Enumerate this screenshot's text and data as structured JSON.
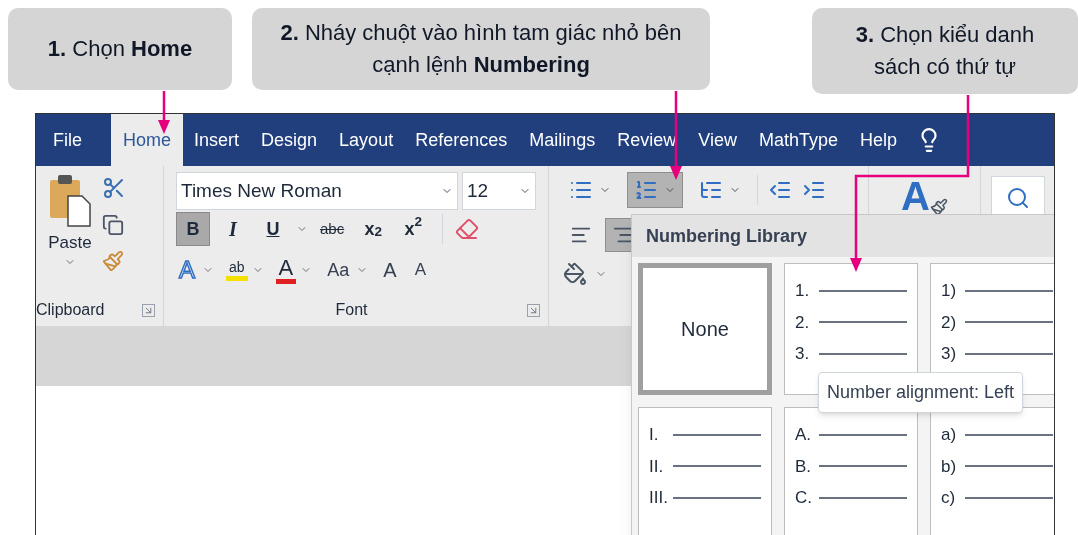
{
  "callouts": [
    {
      "text": "**1.** Chọn **Home**"
    },
    {
      "text": "**2.** Nháy chuột vào hình tam giác nhỏ bên cạnh lệnh **Numbering**"
    },
    {
      "text": "**3.** Chọn kiểu danh sách có thứ tự"
    }
  ],
  "tabs": [
    {
      "label": "File",
      "selected": false
    },
    {
      "label": "Home",
      "selected": true
    },
    {
      "label": "Insert",
      "selected": false
    },
    {
      "label": "Design",
      "selected": false
    },
    {
      "label": "Layout",
      "selected": false
    },
    {
      "label": "References",
      "selected": false
    },
    {
      "label": "Mailings",
      "selected": false
    },
    {
      "label": "Review",
      "selected": false
    },
    {
      "label": "View",
      "selected": false
    },
    {
      "label": "MathType",
      "selected": false
    },
    {
      "label": "Help",
      "selected": false
    }
  ],
  "ribbon": {
    "clipboard": {
      "paste_label": "Paste",
      "group_label": "Clipboard"
    },
    "font": {
      "font_name": "Times New Roman",
      "font_size": "12",
      "group_label": "Font",
      "format_buttons": [
        {
          "kind": "bold",
          "label": "B",
          "selected": true
        },
        {
          "kind": "italic",
          "label": "I",
          "selected": false
        },
        {
          "kind": "underline",
          "label": "U",
          "selected": false
        },
        {
          "kind": "strike",
          "label": "abc",
          "selected": false
        },
        {
          "kind": "sub",
          "label": "x$_{2}$",
          "selected": false
        },
        {
          "kind": "super",
          "label": "x$^{2}$",
          "selected": false
        }
      ],
      "effect_buttons": [
        {
          "kind": "effects",
          "label": "A"
        },
        {
          "kind": "highlight",
          "label": "ab"
        },
        {
          "kind": "color",
          "label": "A"
        },
        {
          "kind": "case",
          "label": "Aa"
        },
        {
          "kind": "grow",
          "label": "A"
        },
        {
          "kind": "shrink",
          "label": "A"
        }
      ]
    },
    "paragraph": {
      "list_buttons": [
        {
          "kind": "bullets",
          "selected": false
        },
        {
          "kind": "numbering",
          "selected": true
        },
        {
          "kind": "multilevel",
          "selected": false
        }
      ],
      "align_buttons": [
        {
          "kind": "left",
          "selected": false
        },
        {
          "kind": "right",
          "selected": true
        }
      ]
    },
    "styles": {
      "label": "A"
    }
  },
  "numbering_library": {
    "title": "Numbering Library",
    "items": [
      {
        "kind": "none",
        "label": "None",
        "selected": true
      },
      {
        "kind": "list",
        "markers": [
          "1.",
          "2.",
          "3."
        ],
        "selected": false
      },
      {
        "kind": "list",
        "markers": [
          "1)",
          "2)",
          "3)"
        ],
        "selected": false
      },
      {
        "kind": "list",
        "markers": [
          "I.",
          "II.",
          "III."
        ],
        "selected": false
      },
      {
        "kind": "list",
        "markers": [
          "A.",
          "B.",
          "C."
        ],
        "selected": false
      },
      {
        "kind": "list",
        "markers": [
          "a)",
          "b)",
          "c)"
        ],
        "selected": false
      }
    ]
  },
  "tooltip": "Number alignment: Left"
}
